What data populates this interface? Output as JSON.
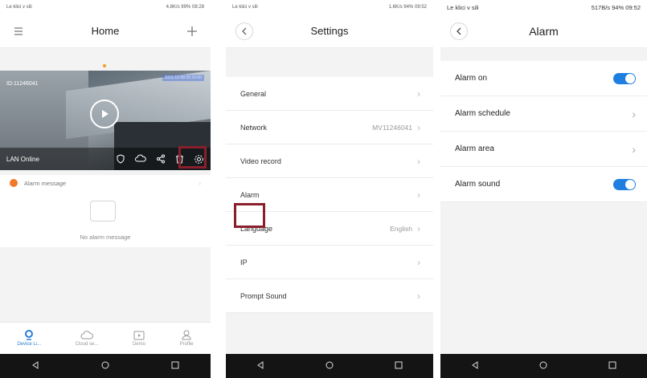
{
  "home": {
    "status_left": "Le klici v sili",
    "status_right": "4.8K/s 99% 08:28",
    "title": "Home",
    "camera_id": "ID:11246041",
    "camera_timestamp": "2021-12-09 00:15:00",
    "connection_status": "LAN Online",
    "alarm_message_label": "Alarm message",
    "no_alarm_text": "No alarm message",
    "tabs": [
      {
        "label": "Device Li...",
        "icon": "camera-icon",
        "active": true
      },
      {
        "label": "Cloud se...",
        "icon": "cloud-icon",
        "active": false
      },
      {
        "label": "Demo",
        "icon": "play-icon",
        "active": false
      },
      {
        "label": "Profile",
        "icon": "person-icon",
        "active": false
      }
    ]
  },
  "settings": {
    "status_left": "Le klici v sili",
    "status_right": "1.6K/s 94% 09:52",
    "title": "Settings",
    "rows": [
      {
        "label": "General",
        "value": ""
      },
      {
        "label": "Network",
        "value": "MV11246041"
      },
      {
        "label": "Video record",
        "value": ""
      },
      {
        "label": "Alarm",
        "value": ""
      },
      {
        "label": "Language",
        "value": "English"
      },
      {
        "label": "IP",
        "value": ""
      },
      {
        "label": "Prompt Sound",
        "value": ""
      }
    ]
  },
  "alarm": {
    "status_left": "Le klici v sili",
    "status_right": "517B/s 94% 09:52",
    "title": "Alarm",
    "rows": [
      {
        "label": "Alarm on",
        "kind": "toggle",
        "on": true
      },
      {
        "label": "Alarm schedule",
        "kind": "link"
      },
      {
        "label": "Alarm area",
        "kind": "link"
      },
      {
        "label": "Alarm sound",
        "kind": "toggle",
        "on": true
      }
    ]
  },
  "colors": {
    "accent": "#1e7fe0",
    "highlight": "#8a1f2c",
    "alarm_badge": "#f07a2a"
  }
}
